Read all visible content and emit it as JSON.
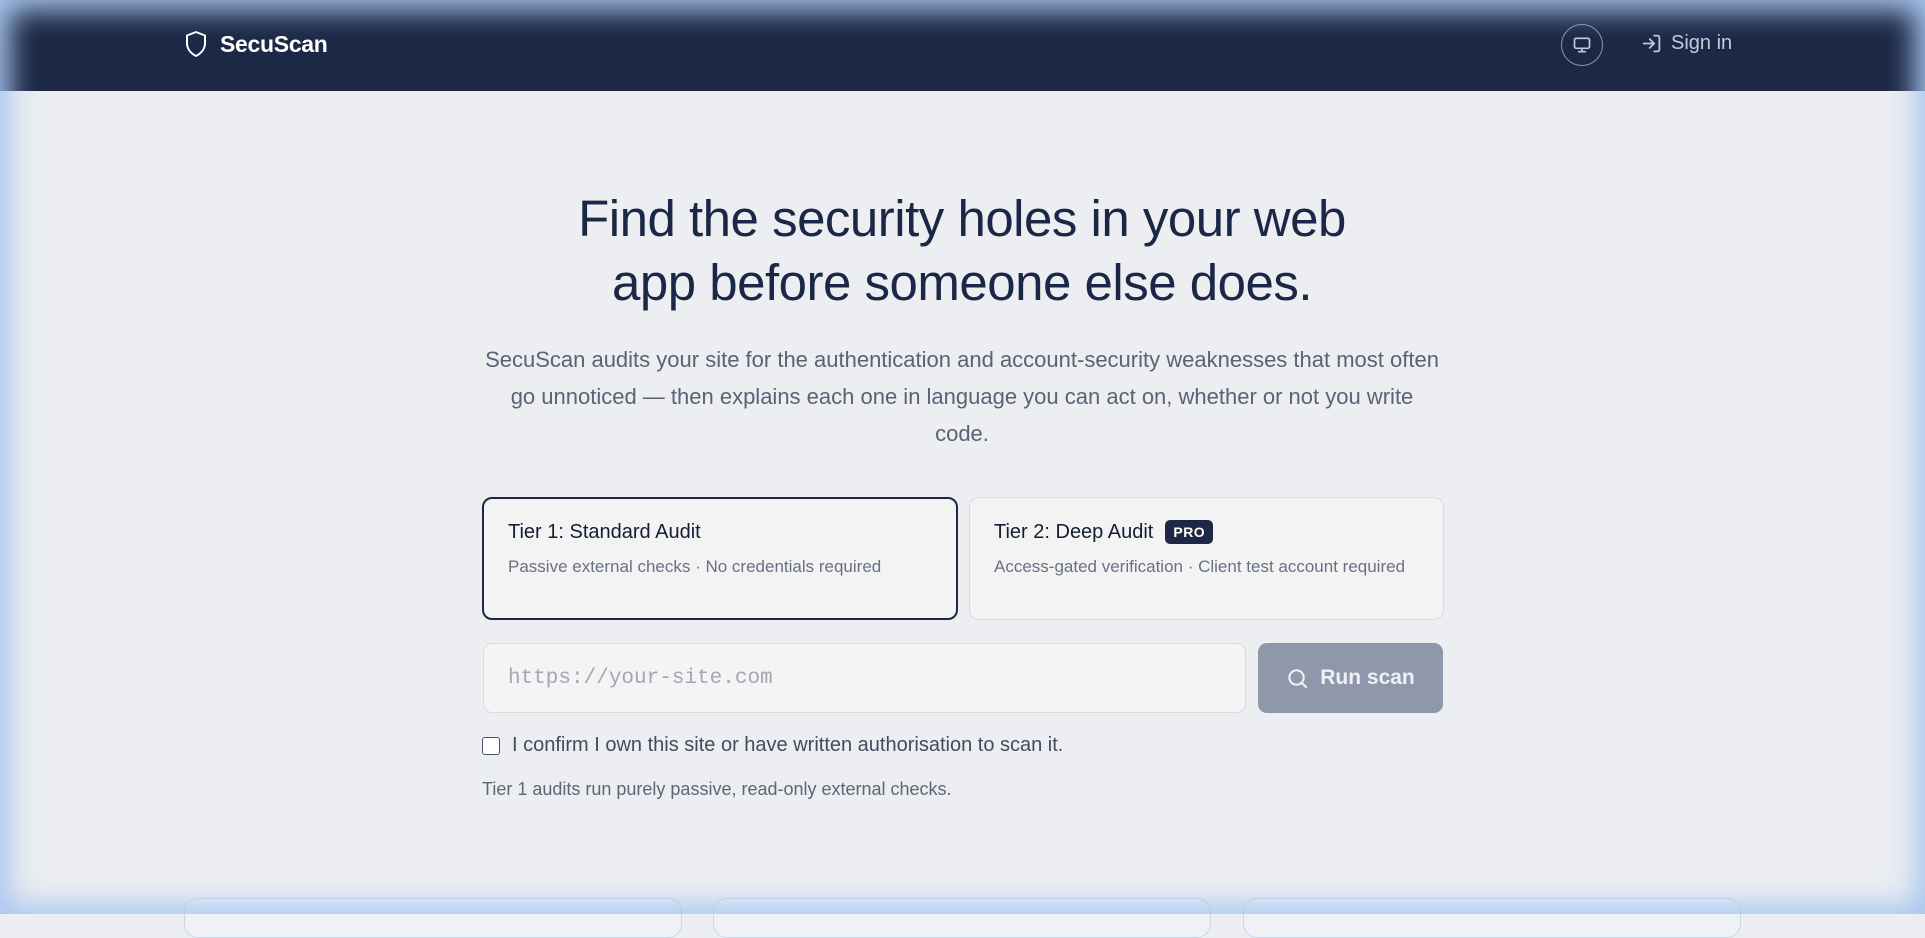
{
  "header": {
    "brand": "SecuScan",
    "theme_toggle_icon": "monitor-icon",
    "signin_label": "Sign in",
    "signin_icon": "sign-in-icon"
  },
  "hero": {
    "title_line1": "Find the security holes in your web",
    "title_line2": "app before someone else does.",
    "lead": "SecuScan audits your site for the authentication and account-security weaknesses that most often go unnoticed — then explains each one in language you can act on, whether or not you write code."
  },
  "tiers": [
    {
      "title": "Tier 1: Standard Audit",
      "subtitle": "Passive external checks · No credentials required",
      "selected": true
    },
    {
      "title": "Tier 2: Deep Audit",
      "badge": "PRO",
      "subtitle": "Access-gated verification · Client test account required",
      "selected": false
    }
  ],
  "scan": {
    "url_placeholder": "https://your-site.com",
    "url_value": "",
    "run_label": "Run scan",
    "run_icon": "search-icon",
    "confirm_label": "I confirm I own this site or have written authorisation to scan it.",
    "confirm_checked": false,
    "note": "Tier 1 audits run purely passive, read-only external checks."
  },
  "colors": {
    "header_bg": "#1c2845",
    "page_bg": "#eceef1",
    "accent": "#1c2845",
    "run_button_disabled": "#8f98aa"
  }
}
